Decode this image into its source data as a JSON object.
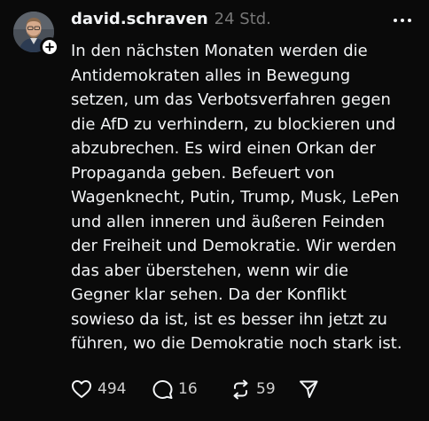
{
  "post": {
    "username": "david.schraven",
    "timestamp": "24 Std.",
    "text": "In den nächsten Monaten werden die\nAntidemokraten alles in Bewegung\nsetzen, um das Verbotsverfahren gegen\ndie AfD zu verhindern, zu blockieren und\nabzubrechen. Es wird einen Orkan der\nPropaganda geben. Befeuert von\nWagenknecht, Putin, Trump, Musk, LePen\nund allen inneren und äußeren Feinden\nder Freiheit und Demokratie. Wir werden\ndas aber überstehen, wenn wir die\nGegner klar sehen. Da der Konflikt\nsowieso da ist, ist es besser ihn jetzt zu\nführen, wo die Demokratie noch stark ist."
  },
  "actions": {
    "likes": "494",
    "replies": "16",
    "reposts": "59"
  },
  "icons": {
    "more": "more-horizontal-icon",
    "follow": "plus-icon",
    "like": "heart-icon",
    "reply": "comment-icon",
    "repost": "repost-icon",
    "share": "send-icon"
  },
  "colors": {
    "background": "#0a0a0a",
    "text": "#f3f5f7",
    "muted": "#777777"
  }
}
